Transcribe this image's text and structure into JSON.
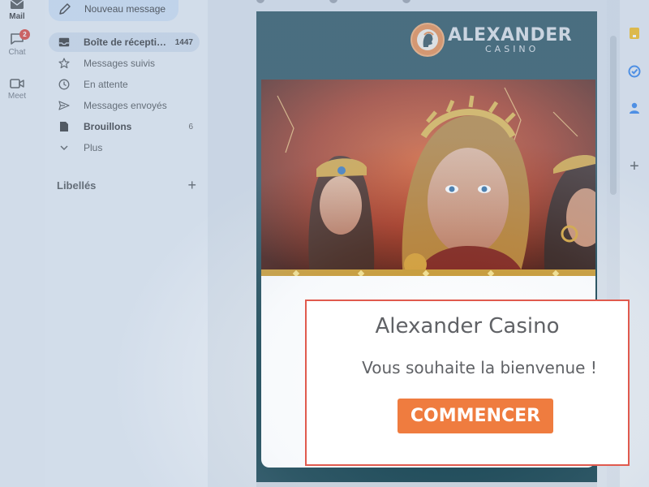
{
  "rail": {
    "mail_label": "Mail",
    "chat_label": "Chat",
    "chat_badge": "2",
    "meet_label": "Meet"
  },
  "compose": {
    "label": "Nouveau message",
    "icon": "pencil-icon"
  },
  "nav": {
    "items": [
      {
        "label": "Boîte de récepti…",
        "count": "1447",
        "icon": "inbox-icon"
      },
      {
        "label": "Messages suivis",
        "count": "",
        "icon": "star-icon"
      },
      {
        "label": "En attente",
        "count": "",
        "icon": "clock-icon"
      },
      {
        "label": "Messages envoyés",
        "count": "",
        "icon": "send-icon"
      },
      {
        "label": "Brouillons",
        "count": "6",
        "icon": "draft-icon"
      },
      {
        "label": "Plus",
        "count": "",
        "icon": "chevron-down-icon"
      }
    ],
    "labels_heading": "Libellés",
    "labels_add": "+"
  },
  "email": {
    "logo_title": "ALEXANDER",
    "logo_subtitle": "CASINO",
    "welcome_title": "Alexander Casino",
    "welcome_subtitle": "Vous souhaite la bienvenue !",
    "cta_label": "COMMENCER"
  },
  "side_panel": {
    "icons": [
      "keep-icon",
      "tasks-icon",
      "contacts-icon",
      "add-icon"
    ],
    "add_label": "+"
  },
  "colors": {
    "accent_orange": "#ef7c3f",
    "highlight_border": "#e05a4e",
    "email_bg": "#13414f",
    "active_nav": "#cbd8e8",
    "badge_red": "#d93025"
  }
}
